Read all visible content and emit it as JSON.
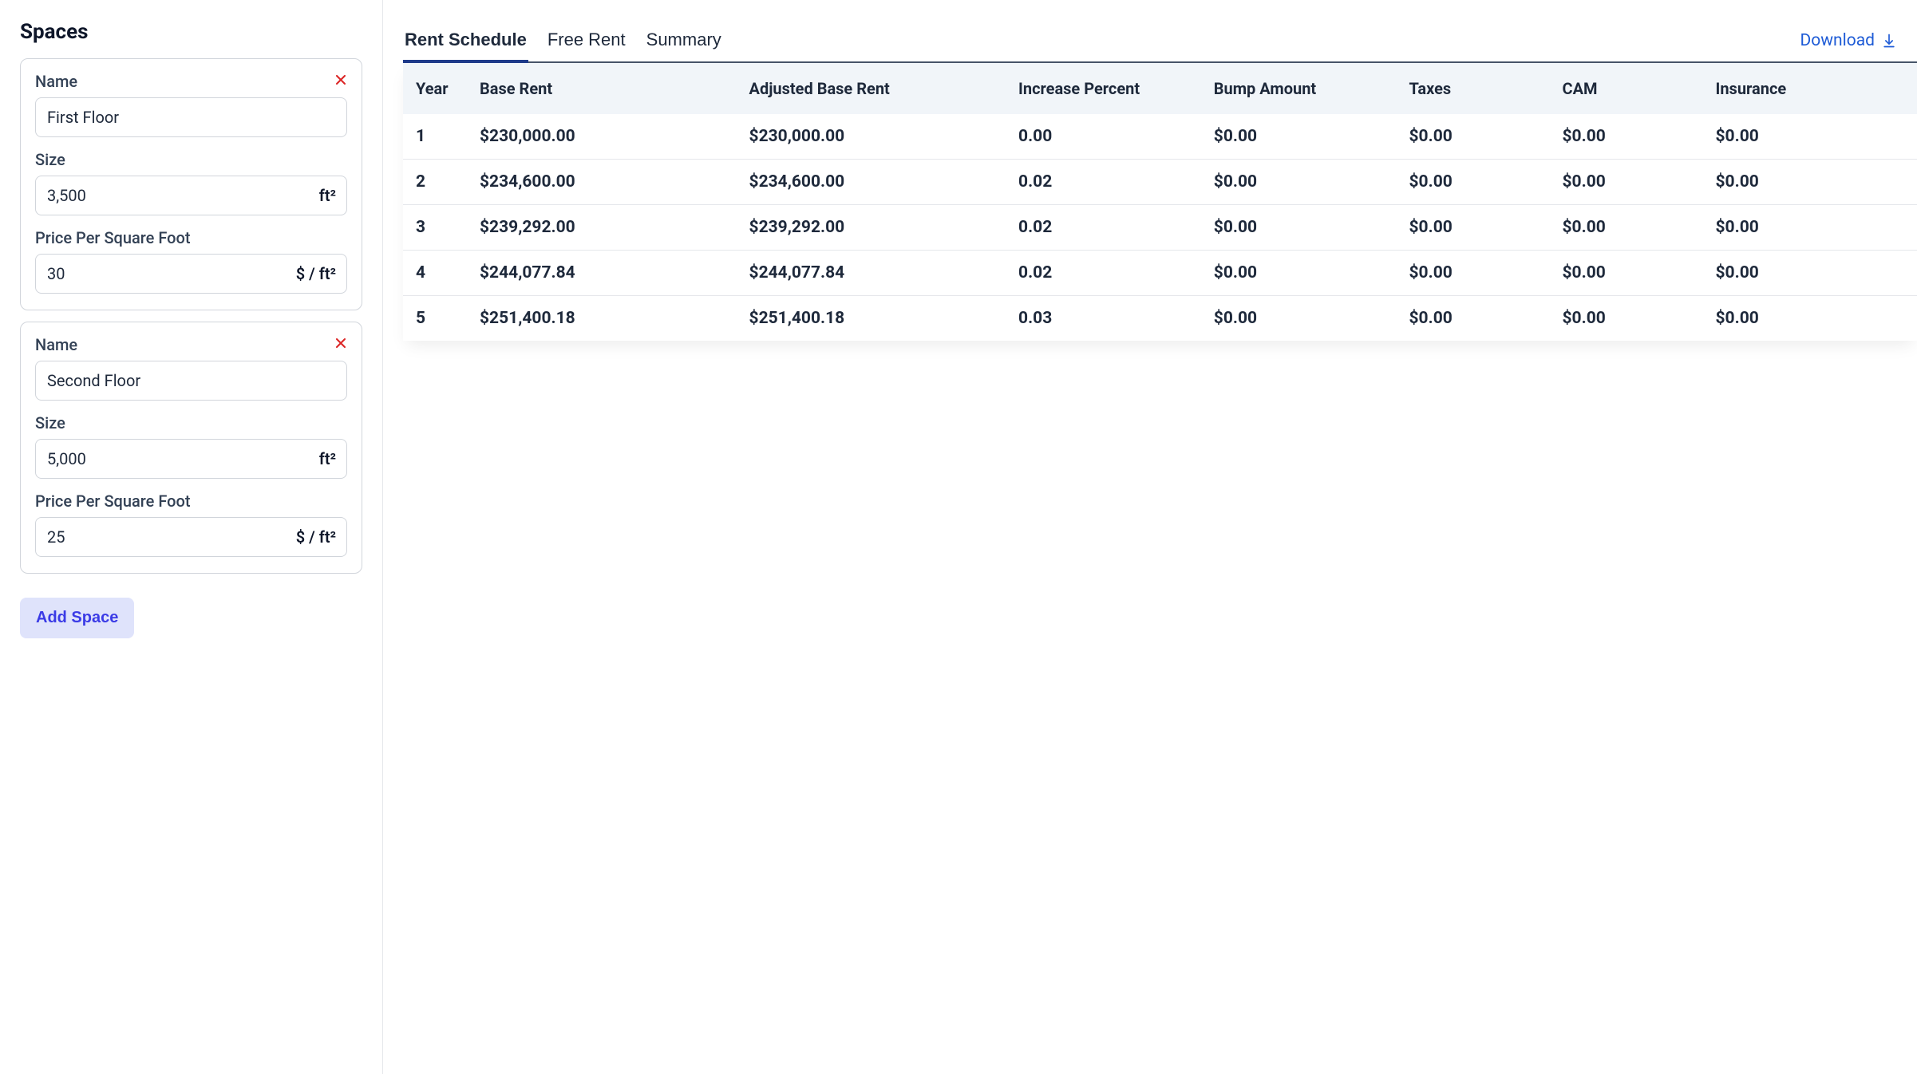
{
  "sidebar": {
    "title": "Spaces",
    "labels": {
      "name": "Name",
      "size": "Size",
      "price": "Price Per Square Foot"
    },
    "units": {
      "size": "ft²",
      "price": "$ / ft²"
    },
    "spaces": [
      {
        "name": "First Floor",
        "size": "3,500",
        "price": "30"
      },
      {
        "name": "Second Floor",
        "size": "5,000",
        "price": "25"
      }
    ],
    "add_button": "Add Space"
  },
  "main": {
    "tabs": [
      {
        "label": "Rent Schedule",
        "active": true
      },
      {
        "label": "Free Rent",
        "active": false
      },
      {
        "label": "Summary",
        "active": false
      }
    ],
    "download": "Download",
    "table": {
      "columns": [
        "Year",
        "Base Rent",
        "Adjusted Base Rent",
        "Increase Percent",
        "Bump Amount",
        "Taxes",
        "CAM",
        "Insurance"
      ],
      "rows": [
        {
          "year": "1",
          "base_rent": "$230,000.00",
          "adjusted": "$230,000.00",
          "increase": "0.00",
          "bump": "$0.00",
          "taxes": "$0.00",
          "cam": "$0.00",
          "insurance": "$0.00"
        },
        {
          "year": "2",
          "base_rent": "$234,600.00",
          "adjusted": "$234,600.00",
          "increase": "0.02",
          "bump": "$0.00",
          "taxes": "$0.00",
          "cam": "$0.00",
          "insurance": "$0.00"
        },
        {
          "year": "3",
          "base_rent": "$239,292.00",
          "adjusted": "$239,292.00",
          "increase": "0.02",
          "bump": "$0.00",
          "taxes": "$0.00",
          "cam": "$0.00",
          "insurance": "$0.00"
        },
        {
          "year": "4",
          "base_rent": "$244,077.84",
          "adjusted": "$244,077.84",
          "increase": "0.02",
          "bump": "$0.00",
          "taxes": "$0.00",
          "cam": "$0.00",
          "insurance": "$0.00"
        },
        {
          "year": "5",
          "base_rent": "$251,400.18",
          "adjusted": "$251,400.18",
          "increase": "0.03",
          "bump": "$0.00",
          "taxes": "$0.00",
          "cam": "$0.00",
          "insurance": "$0.00"
        }
      ]
    }
  }
}
